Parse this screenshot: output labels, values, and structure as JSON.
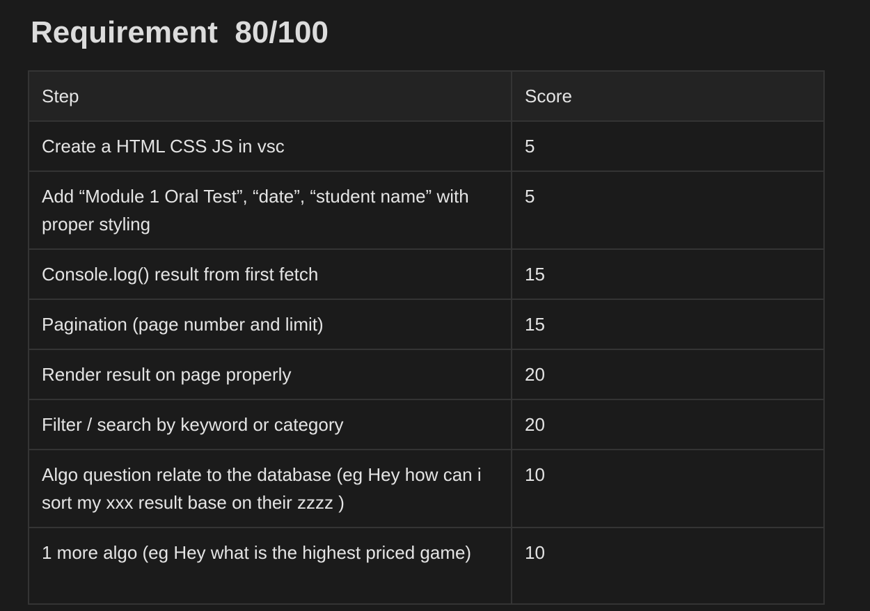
{
  "heading": {
    "title": "Requirement",
    "score": "80/100"
  },
  "table": {
    "columns": [
      "Step",
      "Score"
    ],
    "rows": [
      {
        "step": "Create a HTML CSS JS in vsc",
        "score": "5"
      },
      {
        "step": "Add “Module 1 Oral Test”, “date”, “student name” with proper styling",
        "score": "5"
      },
      {
        "step": "Console.log() result from first fetch",
        "score": "15"
      },
      {
        "step": "Pagination (page number and limit)",
        "score": "15"
      },
      {
        "step": "Render result on page properly",
        "score": "20"
      },
      {
        "step": "Filter / search by keyword or category",
        "score": "20"
      },
      {
        "step": "Algo question relate to the database (eg Hey how can i sort my xxx result base on their zzzz )",
        "score": "10"
      },
      {
        "step": "1 more algo (eg Hey what is the highest priced game)",
        "score": "10"
      }
    ]
  }
}
